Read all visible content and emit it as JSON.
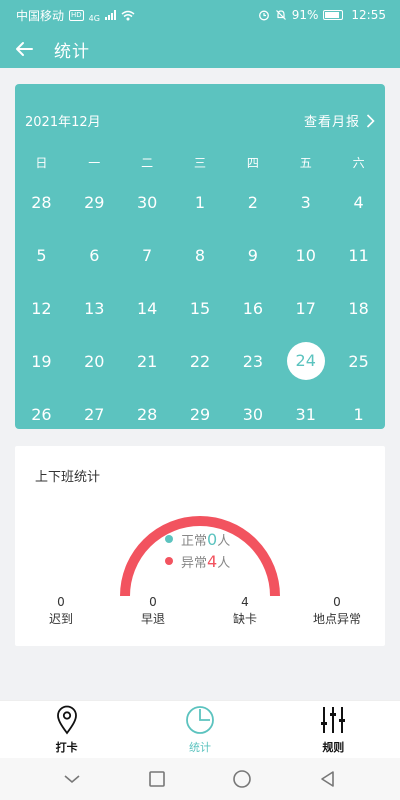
{
  "status_bar": {
    "carrier": "中国移动",
    "hd_badge": "HD",
    "network": "4G",
    "battery": "91%",
    "time": "12:55"
  },
  "header": {
    "title": "统计",
    "back_icon": "arrow-left-icon"
  },
  "calendar": {
    "month_label": "2021年12月",
    "monthly_report_label": "查看月报",
    "weekdays": [
      "日",
      "一",
      "二",
      "三",
      "四",
      "五",
      "六"
    ],
    "weeks": [
      [
        "28",
        "29",
        "30",
        "1",
        "2",
        "3",
        "4"
      ],
      [
        "5",
        "6",
        "7",
        "8",
        "9",
        "10",
        "11"
      ],
      [
        "12",
        "13",
        "14",
        "15",
        "16",
        "17",
        "18"
      ],
      [
        "19",
        "20",
        "21",
        "22",
        "23",
        "24",
        "25"
      ],
      [
        "26",
        "27",
        "28",
        "29",
        "30",
        "31",
        "1"
      ]
    ],
    "selected_day": "24"
  },
  "stats": {
    "title": "上下班统计",
    "normal_label": "正常",
    "normal_count": "0",
    "abnormal_label": "异常",
    "abnormal_count": "4",
    "person_unit": "人",
    "items": [
      {
        "value": "0",
        "label": "迟到"
      },
      {
        "value": "0",
        "label": "早退"
      },
      {
        "value": "4",
        "label": "缺卡"
      },
      {
        "value": "0",
        "label": "地点异常"
      }
    ]
  },
  "bottom_nav": {
    "items": [
      {
        "label": "打卡",
        "icon": "location-pin-icon"
      },
      {
        "label": "统计",
        "icon": "pie-chart-icon"
      },
      {
        "label": "规则",
        "icon": "sliders-icon"
      }
    ],
    "active_index": 1
  },
  "colors": {
    "primary": "#5cc3bf",
    "abnormal": "#f2535f",
    "background": "#f1f2f4"
  }
}
